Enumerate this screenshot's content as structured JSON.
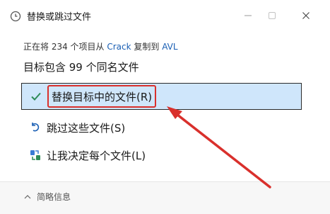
{
  "window": {
    "title": "替换或跳过文件",
    "icon": "clock-icon"
  },
  "info": {
    "prefix": "正在将 234 个项目从 ",
    "source": "Crack",
    "middle": " 复制到 ",
    "dest": "AVL"
  },
  "heading": "目标包含 99 个同名文件",
  "options": {
    "replace": "替换目标中的文件(R)",
    "skip": "跳过这些文件(S)",
    "decide": "让我决定每个文件(L)"
  },
  "footer": {
    "toggle": "简略信息"
  },
  "colors": {
    "highlight": "#cfe6fb",
    "annotation": "#d9302c",
    "check": "#2e8b57",
    "link": "#1a5fb4"
  }
}
